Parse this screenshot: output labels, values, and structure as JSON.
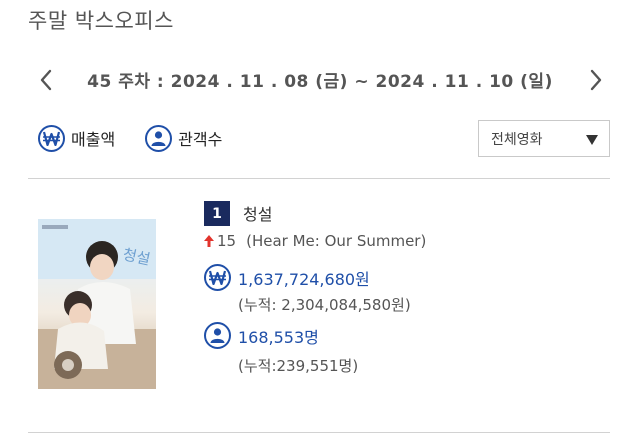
{
  "page_title": "주말 박스오피스",
  "week_nav": {
    "label": "45 주차  :  2024 . 11 . 08 (금)  ~  2024 . 11 . 10 (일)"
  },
  "toggles": [
    {
      "label": "매출액",
      "icon": "won-icon"
    },
    {
      "label": "관객수",
      "icon": "person-icon"
    }
  ],
  "filter": {
    "selected": "전체영화"
  },
  "colors": {
    "accent": "#1f4fa8",
    "badge": "#1a2a5e",
    "up": "#e2342d"
  },
  "movies": [
    {
      "rank": "1",
      "title": "청설",
      "rank_change": "15",
      "change_direction": "up",
      "english_title": "(Hear Me: Our Summer)",
      "sales": "1,637,724,680원",
      "sales_cumulative": "(누적: 2,304,084,580원)",
      "audience": "168,553명",
      "audience_cumulative": "(누적:239,551명)",
      "poster_title": "청설"
    }
  ]
}
